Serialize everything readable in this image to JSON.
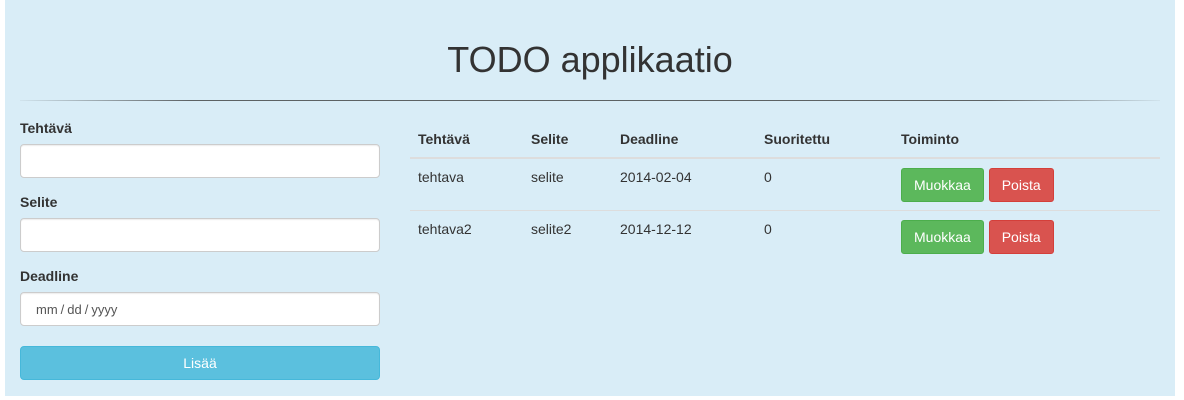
{
  "header": {
    "title": "TODO applikaatio"
  },
  "form": {
    "task_label": "Tehtävä",
    "task_value": "",
    "description_label": "Selite",
    "description_value": "",
    "deadline_label": "Deadline",
    "deadline_placeholder_month": "mm",
    "deadline_placeholder_day": "dd",
    "deadline_placeholder_year": "yyyy",
    "date_separator": "/",
    "add_button_label": "Lisää"
  },
  "table": {
    "headers": {
      "task": "Tehtävä",
      "description": "Selite",
      "deadline": "Deadline",
      "done": "Suoritettu",
      "actions": "Toiminto"
    },
    "rows": [
      {
        "task": "tehtava",
        "description": "selite",
        "deadline": "2014-02-04",
        "done": "0"
      },
      {
        "task": "tehtava2",
        "description": "selite2",
        "deadline": "2014-12-12",
        "done": "0"
      }
    ],
    "edit_label": "Muokkaa",
    "delete_label": "Poista"
  },
  "colors": {
    "background": "#d9edf7",
    "add_button": "#5bc0de",
    "edit_button": "#5cb85c",
    "delete_button": "#d9534f"
  }
}
